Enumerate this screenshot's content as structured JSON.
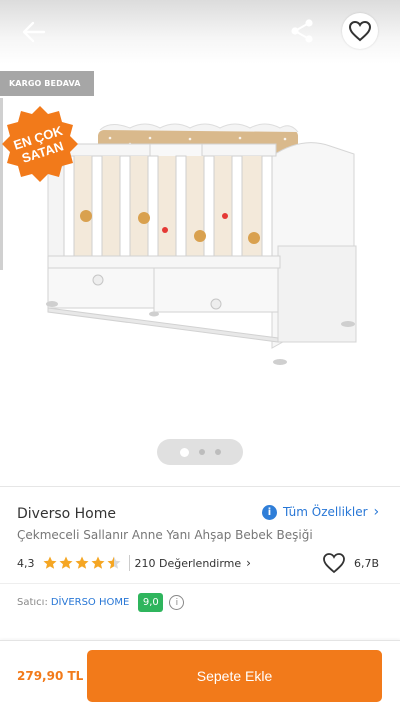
{
  "header": {
    "back_icon": "arrow-left-icon",
    "share_icon": "share-icon",
    "favorite_icon": "heart-outline-icon"
  },
  "gallery": {
    "badge_text": "KARGO BEDAVA",
    "bestseller_line1": "EN ÇOK",
    "bestseller_line2": "SATAN",
    "page_count": 3,
    "active_index": 0
  },
  "product": {
    "brand": "Diverso Home",
    "all_features_label": "Tüm Özellikler",
    "all_features_arrow": "›",
    "title": "Çekmeceli Sallanır Anne Yanı Ahşap Bebek Beşiği",
    "rating_score": "4,3",
    "stars": 4.5,
    "reviews_label": "210 Değerlendirme",
    "reviews_arrow": "›",
    "favorites_count": "6,7B"
  },
  "seller": {
    "label": "Satıcı:",
    "name": "DİVERSO HOME",
    "score": "9,0",
    "info_glyph": "i"
  },
  "footer": {
    "price": "279,90 TL",
    "add_to_cart_label": "Sepete Ekle"
  },
  "colors": {
    "accent": "#f27a1a",
    "link": "#2877d6",
    "seller_score": "#2fb55d",
    "star": "#f5a623"
  }
}
